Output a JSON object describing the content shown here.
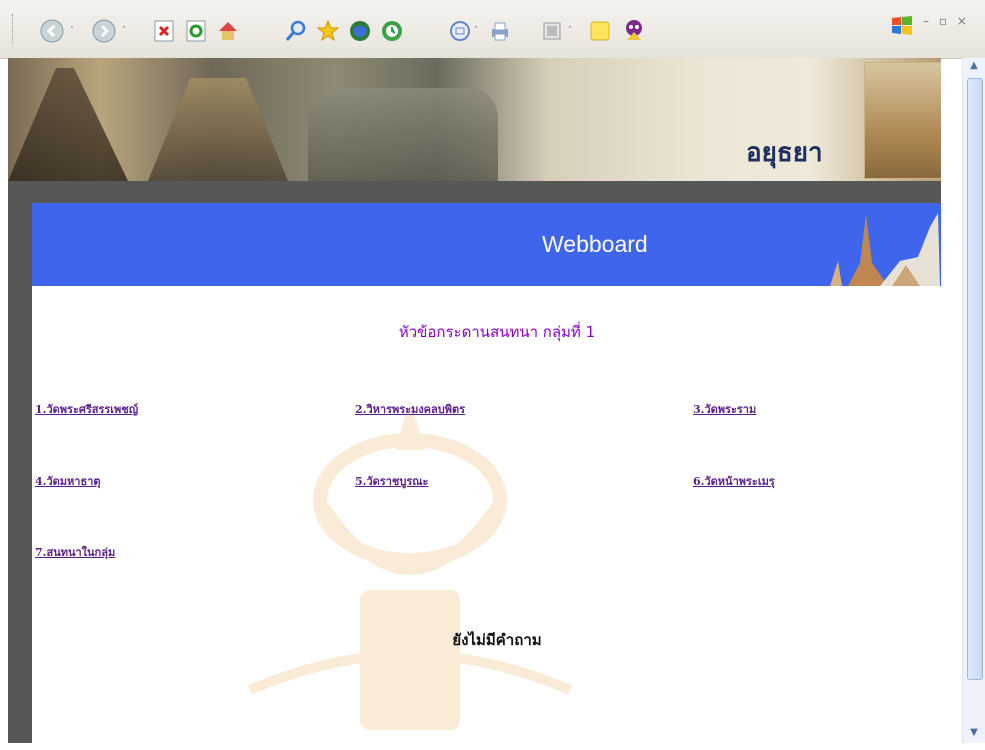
{
  "toolbar": {
    "buttons": [
      {
        "name": "back-icon",
        "glyph": "◀"
      },
      {
        "name": "forward-icon",
        "glyph": "▶"
      },
      {
        "name": "stop-icon",
        "glyph": "✖"
      },
      {
        "name": "refresh-icon",
        "glyph": "⟳"
      },
      {
        "name": "home-icon",
        "glyph": "⌂"
      },
      {
        "name": "search-icon",
        "glyph": "⌕"
      },
      {
        "name": "favorites-icon",
        "glyph": "★"
      },
      {
        "name": "media-icon",
        "glyph": "◉"
      },
      {
        "name": "history-icon",
        "glyph": "◷"
      },
      {
        "name": "mail-icon",
        "glyph": "✉"
      },
      {
        "name": "print-icon",
        "glyph": "⎙"
      },
      {
        "name": "edit-icon",
        "glyph": "▦"
      },
      {
        "name": "notes-icon",
        "glyph": "▢"
      },
      {
        "name": "messenger-icon",
        "glyph": "☻"
      }
    ]
  },
  "banner": {
    "title": "อยุธยา"
  },
  "header": {
    "label": "Webboard"
  },
  "board": {
    "heading": "หัวข้อกระดานสนทนา กลุ่มที่ 1",
    "topics": [
      "1.วัดพระศรีสรรเพชญ์",
      "2.วิหารพระมงคลบพิตร",
      "3.วัดพระราม",
      "4.วัดมหาธาตุ",
      "5.วัดราชบูรณะ",
      "6.วัดหน้าพระเมรุ",
      "7.สนทนาในกลุ่ม"
    ],
    "empty_message": "ยังไม่มีคำถาม"
  },
  "colors": {
    "header_blue": "#3f65ed",
    "frame": "#575757",
    "link": "#5b1f8f",
    "heading": "#8a00c0"
  }
}
